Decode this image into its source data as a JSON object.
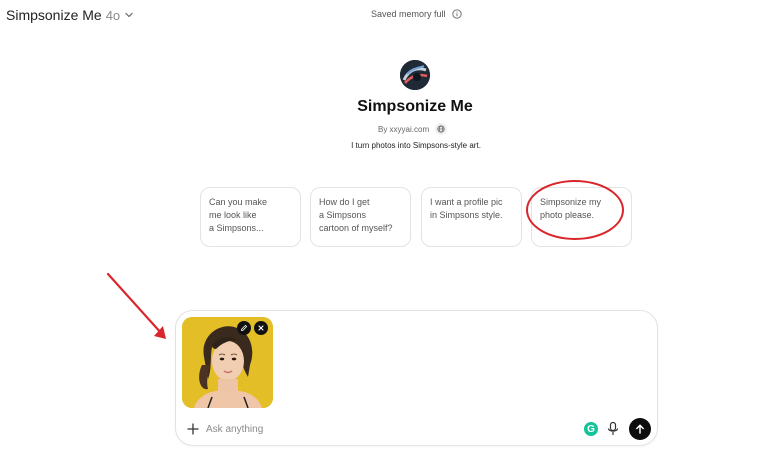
{
  "header": {
    "model_name": "Simpsonize Me",
    "model_version": "4o",
    "memory_status": "Saved memory full"
  },
  "gpt": {
    "title": "Simpsonize Me",
    "byline": "By xxyyai.com",
    "tagline": "I turn photos into Simpsons-style art."
  },
  "starters": [
    {
      "lines": [
        "Can you make",
        "me look like",
        "a Simpsons..."
      ]
    },
    {
      "lines": [
        "How do I get",
        "a Simpsons",
        "cartoon of myself?"
      ]
    },
    {
      "lines": [
        "I want a profile pic",
        "in Simpsons style."
      ]
    },
    {
      "lines": [
        "Simpsonize my",
        "photo please."
      ]
    }
  ],
  "composer": {
    "placeholder": "Ask anything",
    "grammarly_letter": "G"
  },
  "colors": {
    "annotation": "#d9262c",
    "send_button": "#0d0d0d",
    "grammarly": "#15c39a",
    "photo_background": "#e7c52a"
  }
}
